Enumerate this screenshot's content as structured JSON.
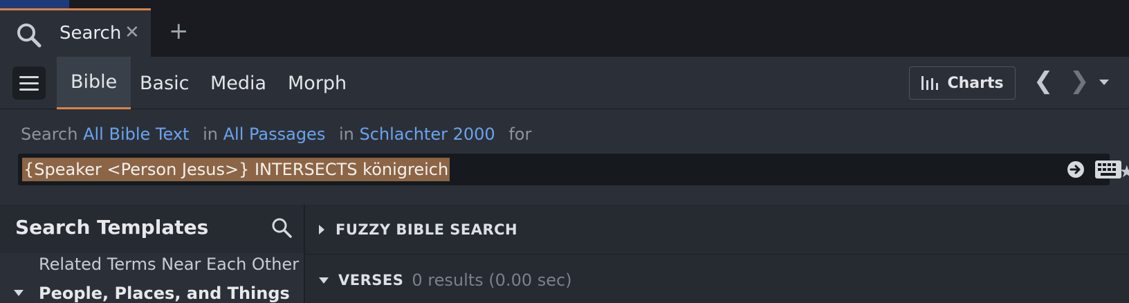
{
  "tabs": {
    "active": {
      "label": "Search",
      "icon": "search-icon",
      "close_glyph": "✕"
    },
    "new_tab_glyph": "+"
  },
  "toolbar": {
    "nav_tabs": [
      "Bible",
      "Basic",
      "Media",
      "Morph"
    ],
    "active_tab": "Bible",
    "charts_label": "Charts",
    "back_glyph": "❮",
    "forward_glyph": "❯"
  },
  "search": {
    "word_search": "Search",
    "scope": "All Bible Text",
    "word_in1": "in",
    "range": "All Passages",
    "word_in2": "in",
    "resource": "Schlachter 2000",
    "word_for": "for",
    "query": "{Speaker <Person Jesus>} INTERSECTS königreich"
  },
  "sidebar": {
    "title": "Search Templates",
    "partial_item": "Related Terms Near Each Other",
    "group": "People, Places, and Things"
  },
  "results": {
    "fuzzy_label": "FUZZY BIBLE SEARCH",
    "verses_label": "VERSES",
    "verses_count": "0 results (0.00 sec)"
  },
  "colors": {
    "accent": "#d9834a",
    "link": "#6aa3ef",
    "highlight": "#8b6546"
  }
}
